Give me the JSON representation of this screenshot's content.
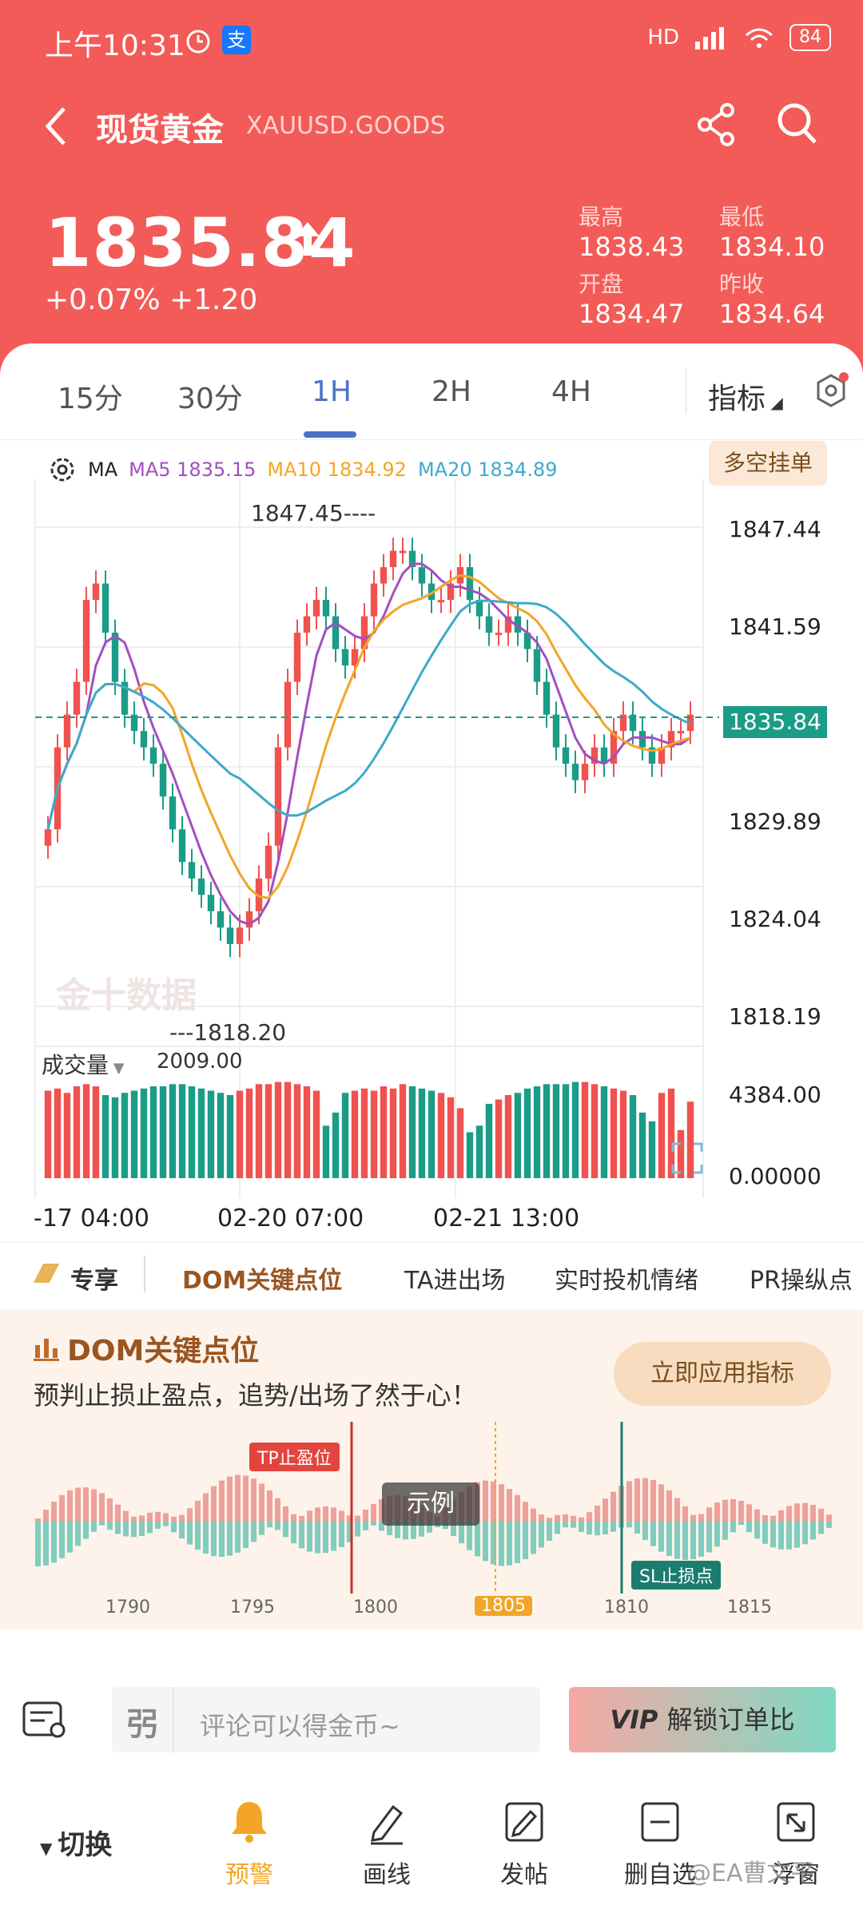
{
  "status": {
    "time": "上午10:31",
    "network": "HD",
    "battery": "84"
  },
  "nav": {
    "title": "现货黄金",
    "symbol": "XAUUSD.GOODS"
  },
  "quote": {
    "price": "1835.84",
    "change": "+0.07%  +1.20",
    "stats": [
      {
        "label": "最高",
        "value": "1838.43"
      },
      {
        "label": "最低",
        "value": "1834.10"
      },
      {
        "label": "开盘",
        "value": "1834.47"
      },
      {
        "label": "昨收",
        "value": "1834.64"
      }
    ]
  },
  "tabs": {
    "items": [
      "15分",
      "30分",
      "1H",
      "2H",
      "4H"
    ],
    "active": "1H",
    "indicator_label": "指标"
  },
  "chart": {
    "ma_label": "MA",
    "ma5": "MA5 1835.15",
    "ma10": "MA10 1834.92",
    "ma20": "MA20 1834.89",
    "badge": "多空挂单",
    "high_mark": "1847.45",
    "low_mark": "1818.20",
    "current_price": "1835.84",
    "watermark": "金十数据",
    "volume_label": "成交量",
    "volume_value": "2009.00",
    "colors": {
      "up": "#f0524f",
      "down": "#1b9c87",
      "ma5": "#a24fc1",
      "ma10": "#f2a526",
      "ma20": "#3ea9cc"
    }
  },
  "chart_data": {
    "type": "candlestick",
    "y_ticks": [
      "1847.44",
      "1841.59",
      "1829.89",
      "1824.04",
      "1818.19"
    ],
    "ylim": [
      1818.19,
      1847.44
    ],
    "volume_ticks": [
      "4384.00",
      "0.00000"
    ],
    "x_ticks": [
      "-17 04:00",
      "02-20 07:00",
      "02-21 13:00"
    ],
    "closes": [
      1829,
      1834,
      1836,
      1838,
      1843,
      1844,
      1841,
      1838,
      1836,
      1835,
      1834,
      1833,
      1831,
      1829,
      1827,
      1826,
      1825,
      1824,
      1823,
      1822,
      1823,
      1824,
      1826,
      1828,
      1834,
      1838,
      1841,
      1842,
      1843,
      1842,
      1840,
      1839,
      1840,
      1842,
      1844,
      1845,
      1846,
      1846,
      1845,
      1844,
      1843,
      1843,
      1844,
      1845,
      1843,
      1842,
      1841,
      1841,
      1842,
      1841,
      1840,
      1838,
      1836,
      1834,
      1833,
      1832,
      1833,
      1834,
      1833,
      1835,
      1836,
      1835,
      1834,
      1833,
      1834,
      1835,
      1835,
      1836
    ],
    "volumes": [
      4000,
      4100,
      3900,
      4200,
      4300,
      4200,
      3800,
      3700,
      3900,
      4000,
      4100,
      4200,
      4200,
      4300,
      4300,
      4200,
      4100,
      4000,
      3900,
      3800,
      4000,
      4100,
      4300,
      4300,
      4400,
      4400,
      4300,
      4200,
      4000,
      2400,
      3000,
      3900,
      4000,
      4100,
      4000,
      4200,
      4100,
      4300,
      4200,
      4100,
      4000,
      3900,
      3700,
      3200,
      2100,
      2400,
      3400,
      3600,
      3800,
      3900,
      4100,
      4200,
      4300,
      4300,
      4300,
      4400,
      4400,
      4300,
      4200,
      4100,
      4000,
      3800,
      3000,
      2600,
      3900,
      4100,
      2200,
      3500
    ]
  },
  "features": {
    "items": [
      "专享",
      "DOM关键点位",
      "TA进出场",
      "实时投机情绪",
      "PR操纵点"
    ]
  },
  "promo": {
    "title": "DOM关键点位",
    "subtitle": "预判止损止盈点，追势/出场了然于心！",
    "button": "立即应用指标",
    "tp_label": "TP止盈位",
    "sl_label": "SL止损点",
    "example_label": "示例",
    "x_ticks": [
      "1790",
      "1795",
      "1800",
      "1805",
      "1810",
      "1815"
    ]
  },
  "bottom": {
    "comment_placeholder": "评论可以得金币~",
    "vip_label": "解锁订单比",
    "switch_label": "切换",
    "toolbar": [
      "预警",
      "画线",
      "发帖",
      "删自选",
      "浮窗"
    ],
    "watermark": "@EA曹文平"
  }
}
